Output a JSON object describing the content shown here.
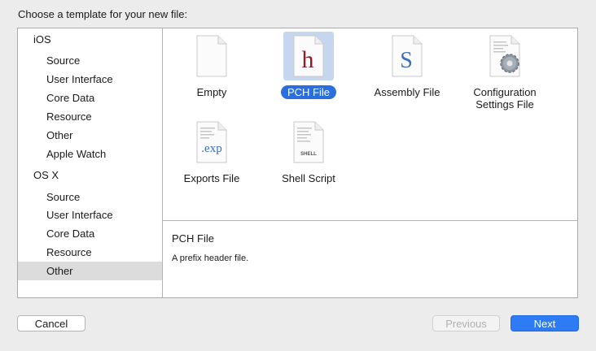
{
  "dialog": {
    "prompt": "Choose a template for your new file:"
  },
  "sidebar": {
    "items": [
      {
        "label": "iOS",
        "kind": "head"
      },
      {
        "label": "Source",
        "kind": "sub"
      },
      {
        "label": "User Interface",
        "kind": "sub"
      },
      {
        "label": "Core Data",
        "kind": "sub"
      },
      {
        "label": "Resource",
        "kind": "sub"
      },
      {
        "label": "Other",
        "kind": "sub"
      },
      {
        "label": "Apple Watch",
        "kind": "sub"
      },
      {
        "label": "OS X",
        "kind": "head"
      },
      {
        "label": "Source",
        "kind": "sub"
      },
      {
        "label": "User Interface",
        "kind": "sub"
      },
      {
        "label": "Core Data",
        "kind": "sub"
      },
      {
        "label": "Resource",
        "kind": "sub"
      },
      {
        "label": "Other",
        "kind": "sub",
        "selected": true
      }
    ]
  },
  "templates": [
    {
      "label": "Empty",
      "icon": "blank-file-icon"
    },
    {
      "label": "PCH File",
      "icon": "pch-file-icon",
      "glyph": "h",
      "selected": true
    },
    {
      "label": "Assembly File",
      "icon": "assembly-file-icon",
      "glyph": "S"
    },
    {
      "label": "Configuration Settings File",
      "label_line1": "Configuration",
      "label_line2": "Settings File",
      "icon": "config-settings-file-icon"
    },
    {
      "label": "Exports File",
      "icon": "exports-file-icon",
      "glyph": ".exp"
    },
    {
      "label": "Shell Script",
      "icon": "shell-script-icon",
      "glyph": "SHELL"
    }
  ],
  "description": {
    "title": "PCH File",
    "body": "A prefix header file."
  },
  "buttons": {
    "cancel": "Cancel",
    "previous": "Previous",
    "next": "Next"
  },
  "colors": {
    "accent": "#2d7cf5",
    "selection_label": "#2a6ee0",
    "selection_tile": "#c6d6ef",
    "sidebar_selected": "#dcdcdc"
  }
}
